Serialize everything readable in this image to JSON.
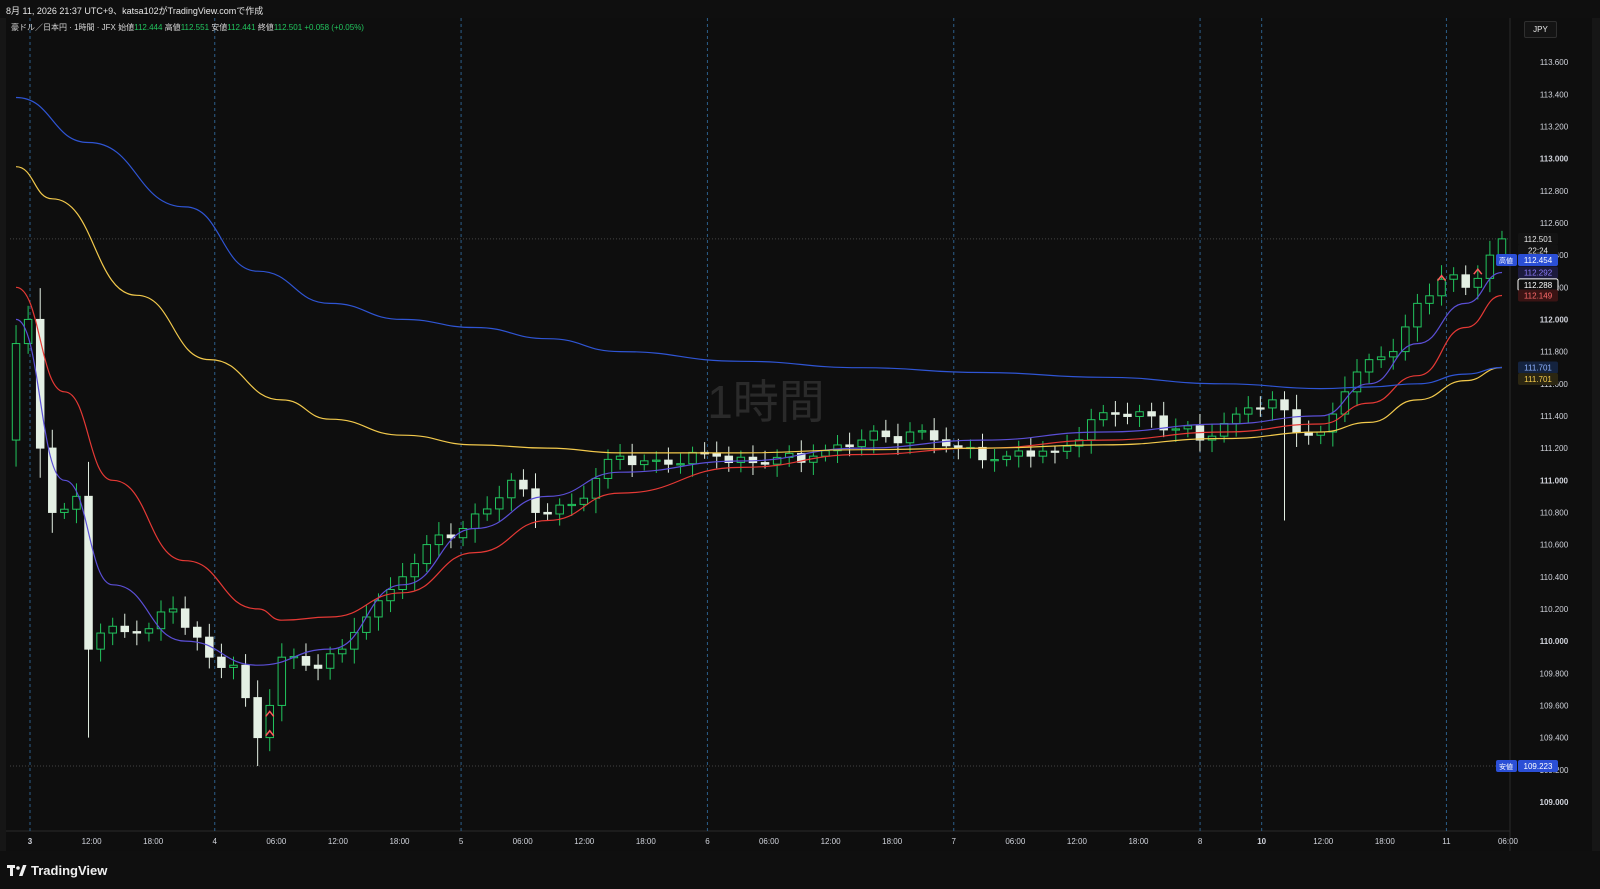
{
  "snapshot": {
    "caption": "8月 11, 2026 21:37 UTC+9、katsa102がTradingView.comで作成"
  },
  "legend": {
    "symbol": "豪ドル／日本円 · 1時間 · JFX",
    "open_label": "始値",
    "open": "112.444",
    "high_label": "高値",
    "high": "112.551",
    "low_label": "安値",
    "low": "112.441",
    "close_label": "終値",
    "close": "112.501",
    "change": "+0.058 (+0.05%)"
  },
  "currency": "JPY",
  "watermark": "1時間",
  "brand": "TradingView",
  "colors": {
    "background": "#0e0e0e",
    "up_candle": "#22c55e",
    "down_candle": "#e4f0e4",
    "ma_fast": "#5b4fd6",
    "ma_mid": "#e53935",
    "ma_slow": "#f2c94c",
    "ma_long": "#2f55d4",
    "session_line": "#2c5f8a",
    "axis_text": "#d1d4dc"
  },
  "chart_data": {
    "type": "candlestick",
    "x_axis": {
      "labels": [
        "3",
        "12:00",
        "18:00",
        "4",
        "06:00",
        "12:00",
        "18:00",
        "5",
        "06:00",
        "12:00",
        "18:00",
        "6",
        "06:00",
        "12:00",
        "18:00",
        "7",
        "06:00",
        "12:00",
        "18:00",
        "8",
        "10",
        "12:00",
        "18:00",
        "11",
        "06:00"
      ],
      "bold": [
        "3",
        "10"
      ],
      "session_starts": [
        "3",
        "4",
        "5",
        "6",
        "7",
        "8",
        "10",
        "11"
      ]
    },
    "y_axis": {
      "ylim": [
        108.9,
        113.75
      ],
      "ticks": [
        "113.600",
        "113.400",
        "113.200",
        "113.000",
        "112.800",
        "112.600",
        "112.400",
        "112.200",
        "112.000",
        "111.800",
        "111.600",
        "111.400",
        "111.200",
        "111.000",
        "110.800",
        "110.600",
        "110.400",
        "110.200",
        "110.000",
        "109.800",
        "109.600",
        "109.400",
        "109.200",
        "109.000"
      ],
      "bold": [
        "113.000",
        "112.000",
        "111.000",
        "110.000",
        "109.000"
      ]
    },
    "candles_count": 124,
    "key_closes": [
      {
        "bar": 0,
        "value": 111.85
      },
      {
        "bar": 1,
        "value": 112.0
      },
      {
        "bar": 2,
        "value": 111.2
      },
      {
        "bar": 3,
        "value": 110.8
      },
      {
        "bar": 4,
        "value": 110.82
      },
      {
        "bar": 5,
        "value": 110.9
      },
      {
        "bar": 6,
        "value": 109.95
      },
      {
        "bar": 7,
        "value": 110.05
      },
      {
        "bar": 10,
        "value": 110.05
      },
      {
        "bar": 13,
        "value": 110.2
      },
      {
        "bar": 16,
        "value": 109.9
      },
      {
        "bar": 18,
        "value": 109.85
      },
      {
        "bar": 20,
        "value": 109.4
      },
      {
        "bar": 21,
        "value": 109.6
      },
      {
        "bar": 22,
        "value": 109.9
      },
      {
        "bar": 24,
        "value": 109.85
      },
      {
        "bar": 27,
        "value": 109.95
      },
      {
        "bar": 29,
        "value": 110.15
      },
      {
        "bar": 32,
        "value": 110.4
      },
      {
        "bar": 34,
        "value": 110.6
      },
      {
        "bar": 37,
        "value": 110.7
      },
      {
        "bar": 41,
        "value": 111.0
      },
      {
        "bar": 43,
        "value": 110.8
      },
      {
        "bar": 46,
        "value": 110.85
      },
      {
        "bar": 50,
        "value": 111.15
      },
      {
        "bar": 54,
        "value": 111.1
      },
      {
        "bar": 58,
        "value": 111.15
      },
      {
        "bar": 62,
        "value": 111.1
      },
      {
        "bar": 66,
        "value": 111.15
      },
      {
        "bar": 70,
        "value": 111.25
      },
      {
        "bar": 74,
        "value": 111.3
      },
      {
        "bar": 78,
        "value": 111.2
      },
      {
        "bar": 82,
        "value": 111.15
      },
      {
        "bar": 86,
        "value": 111.18
      },
      {
        "bar": 90,
        "value": 111.42
      },
      {
        "bar": 94,
        "value": 111.4
      },
      {
        "bar": 98,
        "value": 111.25
      },
      {
        "bar": 102,
        "value": 111.45
      },
      {
        "bar": 104,
        "value": 111.5
      },
      {
        "bar": 106,
        "value": 111.3
      },
      {
        "bar": 108,
        "value": 111.3
      },
      {
        "bar": 110,
        "value": 111.55
      },
      {
        "bar": 112,
        "value": 111.75
      },
      {
        "bar": 114,
        "value": 111.8
      },
      {
        "bar": 116,
        "value": 112.1
      },
      {
        "bar": 118,
        "value": 112.25
      },
      {
        "bar": 120,
        "value": 112.2
      },
      {
        "bar": 122,
        "value": 112.4
      },
      {
        "bar": 123,
        "value": 112.501
      }
    ],
    "moving_averages": [
      {
        "color": "#5b4fd6",
        "knots": [
          [
            0,
            112.0
          ],
          [
            4,
            111.0
          ],
          [
            8,
            110.35
          ],
          [
            14,
            110.0
          ],
          [
            20,
            109.85
          ],
          [
            26,
            109.95
          ],
          [
            32,
            110.35
          ],
          [
            38,
            110.7
          ],
          [
            44,
            110.9
          ],
          [
            50,
            111.05
          ],
          [
            60,
            111.12
          ],
          [
            70,
            111.2
          ],
          [
            80,
            111.25
          ],
          [
            90,
            111.3
          ],
          [
            100,
            111.35
          ],
          [
            108,
            111.4
          ],
          [
            112,
            111.6
          ],
          [
            116,
            111.85
          ],
          [
            120,
            112.1
          ],
          [
            123,
            112.292
          ]
        ]
      },
      {
        "color": "#e53935",
        "knots": [
          [
            0,
            112.2
          ],
          [
            4,
            111.55
          ],
          [
            8,
            111.0
          ],
          [
            14,
            110.5
          ],
          [
            20,
            110.2
          ],
          [
            22,
            110.13
          ],
          [
            26,
            110.15
          ],
          [
            32,
            110.3
          ],
          [
            38,
            110.55
          ],
          [
            44,
            110.75
          ],
          [
            50,
            110.92
          ],
          [
            60,
            111.08
          ],
          [
            70,
            111.16
          ],
          [
            80,
            111.2
          ],
          [
            90,
            111.25
          ],
          [
            100,
            111.3
          ],
          [
            108,
            111.35
          ],
          [
            112,
            111.48
          ],
          [
            116,
            111.65
          ],
          [
            120,
            111.95
          ],
          [
            123,
            112.149
          ]
        ]
      },
      {
        "color": "#f2c94c",
        "knots": [
          [
            0,
            112.95
          ],
          [
            3,
            112.75
          ],
          [
            10,
            112.15
          ],
          [
            16,
            111.75
          ],
          [
            22,
            111.5
          ],
          [
            26,
            111.38
          ],
          [
            32,
            111.28
          ],
          [
            38,
            111.22
          ],
          [
            44,
            111.2
          ],
          [
            50,
            111.17
          ],
          [
            60,
            111.17
          ],
          [
            70,
            111.19
          ],
          [
            80,
            111.2
          ],
          [
            90,
            111.22
          ],
          [
            100,
            111.26
          ],
          [
            108,
            111.3
          ],
          [
            112,
            111.36
          ],
          [
            116,
            111.5
          ],
          [
            120,
            111.62
          ],
          [
            123,
            111.701
          ]
        ]
      },
      {
        "color": "#2f55d4",
        "knots": [
          [
            0,
            113.38
          ],
          [
            6,
            113.1
          ],
          [
            14,
            112.7
          ],
          [
            20,
            112.3
          ],
          [
            26,
            112.1
          ],
          [
            32,
            112.0
          ],
          [
            38,
            111.95
          ],
          [
            44,
            111.88
          ],
          [
            50,
            111.8
          ],
          [
            60,
            111.74
          ],
          [
            70,
            111.7
          ],
          [
            80,
            111.67
          ],
          [
            90,
            111.64
          ],
          [
            100,
            111.6
          ],
          [
            108,
            111.57
          ],
          [
            112,
            111.58
          ],
          [
            116,
            111.6
          ],
          [
            120,
            111.66
          ],
          [
            123,
            111.701
          ]
        ]
      }
    ],
    "price_labels": [
      {
        "text": "112.501",
        "value": 112.501,
        "bg": "#131313",
        "fg": "#e6e6e6"
      },
      {
        "text": "22:24",
        "value": 112.43,
        "bg": "#131313",
        "fg": "#e6e6e6"
      },
      {
        "text": "112.454",
        "value": 112.37,
        "bg": "#2b4fd6",
        "fg": "#ffffff",
        "tag": "高値"
      },
      {
        "text": "112.292",
        "value": 112.292,
        "bg": "#1c1a3d",
        "fg": "#8e7cff"
      },
      {
        "text": "112.288",
        "value": 112.215,
        "bg": "#0e0e0e",
        "fg": "#ffffff",
        "border": "#ffffff"
      },
      {
        "text": "112.149",
        "value": 112.149,
        "bg": "#3a1414",
        "fg": "#ff6b6b"
      },
      {
        "text": "111.701",
        "value": 111.701,
        "bg": "#14233f",
        "fg": "#8fb3ff"
      },
      {
        "text": "111.701",
        "value": 111.63,
        "bg": "#2b2612",
        "fg": "#f2c94c"
      },
      {
        "text": "109.223",
        "value": 109.223,
        "bg": "#2b4fd6",
        "fg": "#ffffff",
        "tag": "安値"
      }
    ],
    "markers": [
      {
        "bar": 21,
        "value": 109.55
      },
      {
        "bar": 21,
        "value": 109.43
      },
      {
        "bar": 118,
        "value": 112.26
      },
      {
        "bar": 121,
        "value": 112.3
      }
    ]
  }
}
